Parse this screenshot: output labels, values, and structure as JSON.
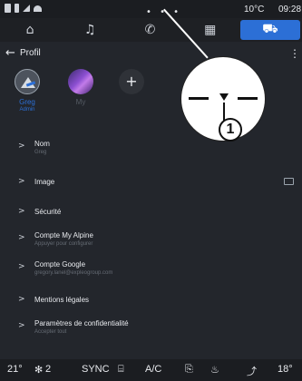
{
  "status": {
    "dots": "• • •",
    "temperature": "10°C",
    "time": "09:28"
  },
  "nav": {
    "tabs": [
      {
        "name": "home-icon",
        "glyph": "⌂"
      },
      {
        "name": "music-icon",
        "glyph": "♫"
      },
      {
        "name": "phone-icon",
        "glyph": "✆"
      },
      {
        "name": "apps-icon",
        "glyph": "▦"
      },
      {
        "name": "car-icon",
        "glyph": "⛟"
      }
    ]
  },
  "header": {
    "back_glyph": "←",
    "title": "Profil",
    "menu_glyph": "⋮"
  },
  "profiles": [
    {
      "name": "Greg",
      "role": "Admin"
    },
    {
      "name": "My",
      "role": ""
    },
    {
      "name": "",
      "role": "",
      "add_glyph": "+"
    }
  ],
  "settings": [
    {
      "label": "Nom",
      "sub": "Greg"
    },
    {
      "label": "Image",
      "sub": ""
    },
    {
      "label": "Sécurité",
      "sub": ""
    },
    {
      "label": "Compte My Alpine",
      "sub": "Appuyer pour configurer"
    },
    {
      "label": "Compte Google",
      "sub": "gregory.lanel@expleogroup.com"
    },
    {
      "label": "Mentions légales",
      "sub": ""
    },
    {
      "label": "Paramètres de confidentialité",
      "sub": "Accepter tout"
    }
  ],
  "chevron": ">",
  "bottom": {
    "temp_left": "21°",
    "fan": "2",
    "sync": "SYNC",
    "ac": "A/C",
    "temp_right": "18°"
  },
  "callout": {
    "number": "1"
  },
  "colors": {
    "accent": "#2c6fd6",
    "background": "#23262c"
  }
}
